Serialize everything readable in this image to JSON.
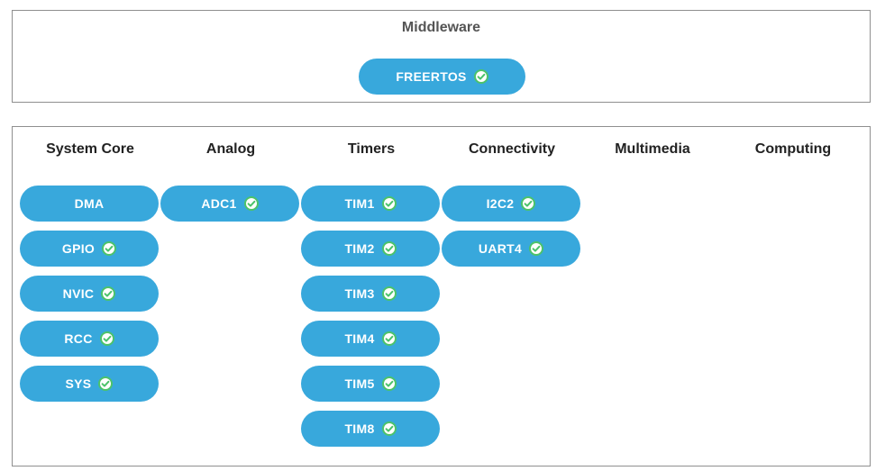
{
  "middleware": {
    "title": "Middleware",
    "items": [
      {
        "label": "FREERTOS",
        "checked": true
      }
    ]
  },
  "categories": [
    {
      "name": "System Core",
      "items": [
        {
          "label": "DMA",
          "checked": false
        },
        {
          "label": "GPIO",
          "checked": true
        },
        {
          "label": "NVIC",
          "checked": true
        },
        {
          "label": "RCC",
          "checked": true
        },
        {
          "label": "SYS",
          "checked": true
        }
      ]
    },
    {
      "name": "Analog",
      "items": [
        {
          "label": "ADC1",
          "checked": true
        }
      ]
    },
    {
      "name": "Timers",
      "items": [
        {
          "label": "TIM1",
          "checked": true
        },
        {
          "label": "TIM2",
          "checked": true
        },
        {
          "label": "TIM3",
          "checked": true
        },
        {
          "label": "TIM4",
          "checked": true
        },
        {
          "label": "TIM5",
          "checked": true
        },
        {
          "label": "TIM8",
          "checked": true
        }
      ]
    },
    {
      "name": "Connectivity",
      "items": [
        {
          "label": "I2C2",
          "checked": true
        },
        {
          "label": "UART4",
          "checked": true
        }
      ]
    },
    {
      "name": "Multimedia",
      "items": []
    },
    {
      "name": "Computing",
      "items": []
    }
  ],
  "colors": {
    "pill": "#38a8dc",
    "check_ring": "#4cc36a",
    "border": "#8f8f8f"
  },
  "icons": {
    "checked": "check-circle-icon"
  }
}
